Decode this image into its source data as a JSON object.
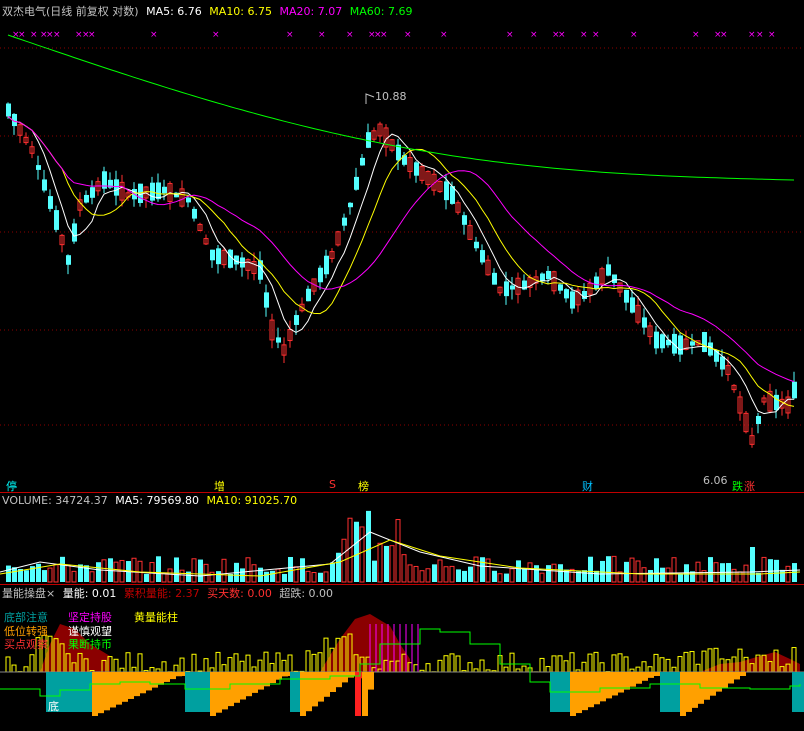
{
  "main": {
    "title": "双杰电气(日线 前复权 对数)",
    "ma": [
      {
        "label": "MA5: 6.76",
        "color": "#ffffff"
      },
      {
        "label": "MA10: 6.75",
        "color": "#ffff00"
      },
      {
        "label": "MA20: 7.07",
        "color": "#ff00ff"
      },
      {
        "label": "MA60: 7.69",
        "color": "#00ff00"
      }
    ],
    "high_label": "10.88",
    "low_label": "6.06",
    "bottom_tags": [
      {
        "text": "停",
        "color": "#00ffff"
      },
      {
        "text": "增",
        "color": "#ffff00"
      },
      {
        "text": "S",
        "color": "#ff3030"
      },
      {
        "text": "榜",
        "color": "#ffff00"
      },
      {
        "text": "财",
        "color": "#00c0ff"
      },
      {
        "text": "跌",
        "color": "#00ff00"
      },
      {
        "text": "涨",
        "color": "#ff3030"
      }
    ],
    "marker_glyph": "×"
  },
  "volume": {
    "label": "VOLUME: 34724.37",
    "ma5": "MA5: 79569.80",
    "ma10": "MA10: 91025.70"
  },
  "indicator": {
    "name": "量能操盘",
    "close_glyph": "×",
    "items": [
      {
        "label": "量能: 0.01",
        "color": "#ffffff"
      },
      {
        "label": "累积量能: 2.37",
        "color": "#c00000"
      },
      {
        "label": "买天数: 0.00",
        "color": "#ff3030"
      },
      {
        "label": "超跌: 0.00",
        "color": "#c0c0c0"
      }
    ],
    "legend": [
      {
        "text": "底部注意",
        "color": "#00a0a0"
      },
      {
        "text": "坚定持股",
        "color": "#ff00ff"
      },
      {
        "text": "黄量能柱",
        "color": "#ffff00"
      },
      {
        "text": "低位转强",
        "color": "#ffa000"
      },
      {
        "text": "谨慎观望",
        "color": "#ffffff"
      },
      {
        "text": "买点观察",
        "color": "#ff3030"
      },
      {
        "text": "果断持币",
        "color": "#00ff00"
      }
    ],
    "bottom_char": "底"
  },
  "colors": {
    "up": "#ff3030",
    "down": "#54ffff",
    "ma5": "#ffffff",
    "ma10": "#ffff00",
    "ma20": "#ff00ff",
    "ma60": "#00ff00",
    "grid": "#8b0000"
  }
}
